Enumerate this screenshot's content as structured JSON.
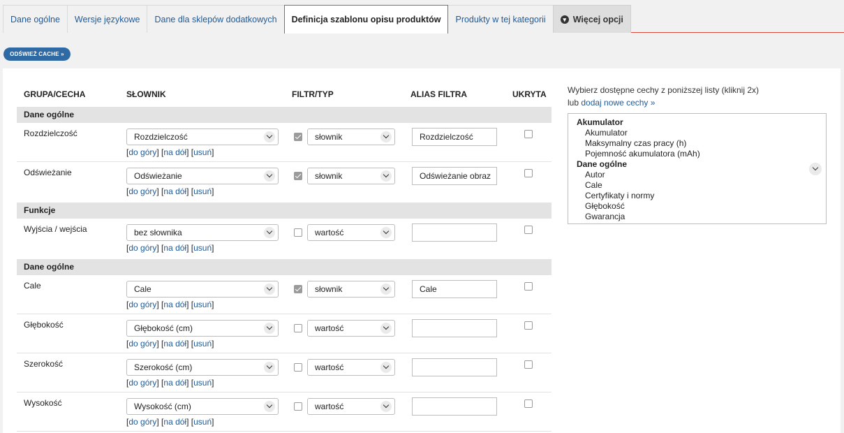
{
  "tabs": [
    {
      "label": "Dane ogólne"
    },
    {
      "label": "Wersje językowe"
    },
    {
      "label": "Dane dla sklepów dodatkowych"
    },
    {
      "label": "Definicja szablonu opisu produktów"
    },
    {
      "label": "Produkty w tej kategorii"
    },
    {
      "label": "Więcej opcji"
    }
  ],
  "refresh_label": "ODŚWIEŻ CACHE »",
  "table": {
    "headers": {
      "group": "GRUPA/CECHA",
      "dictionary": "SŁOWNIK",
      "filter": "FILTR/TYP",
      "alias": "ALIAS FILTRA",
      "hidden": "UKRYTA"
    },
    "groups": [
      "Dane ogólne",
      "Funkcje",
      "Dane ogólne"
    ],
    "rows": [
      {
        "name": "Rozdzielczość",
        "dictionary": "Rozdzielczość",
        "filter_checked": true,
        "type": "słownik",
        "alias": "Rozdzielczość",
        "hidden": false
      },
      {
        "name": "Odświeżanie",
        "dictionary": "Odświeżanie",
        "filter_checked": true,
        "type": "słownik",
        "alias": "Odświeżanie obraz",
        "hidden": false
      },
      {
        "name": "Wyjścia / wejścia",
        "dictionary": "bez słownika",
        "filter_checked": false,
        "type": "wartość",
        "alias": "",
        "hidden": false
      },
      {
        "name": "Cale",
        "dictionary": "Cale",
        "filter_checked": true,
        "type": "słownik",
        "alias": "Cale",
        "hidden": false
      },
      {
        "name": "Głębokość",
        "dictionary": "Głębokość (cm)",
        "filter_checked": false,
        "type": "wartość",
        "alias": "",
        "hidden": false
      },
      {
        "name": "Szerokość",
        "dictionary": "Szerokość (cm)",
        "filter_checked": false,
        "type": "wartość",
        "alias": "",
        "hidden": false
      },
      {
        "name": "Wysokość",
        "dictionary": "Wysokość (cm)",
        "filter_checked": false,
        "type": "wartość",
        "alias": "",
        "hidden": false
      }
    ],
    "links": {
      "open": "[",
      "up": "do góry",
      "mid1": "] [",
      "down": "na dół",
      "mid2": "] [",
      "remove": "usuń",
      "close": "]"
    }
  },
  "side": {
    "instruction": "Wybierz dostępne cechy z poniższej listy (kliknij 2x)",
    "or_prefix": "lub",
    "add_link": "dodaj nowe cechy »",
    "list": [
      {
        "group": "Akumulator",
        "options": [
          "Akumulator",
          "Maksymalny czas pracy (h)",
          "Pojemność akumulatora (mAh)"
        ]
      },
      {
        "group": "Dane ogólne",
        "options": [
          "Autor",
          "Cale",
          "Certyfikaty i normy",
          "Głębokość",
          "Gwarancja"
        ]
      }
    ]
  }
}
